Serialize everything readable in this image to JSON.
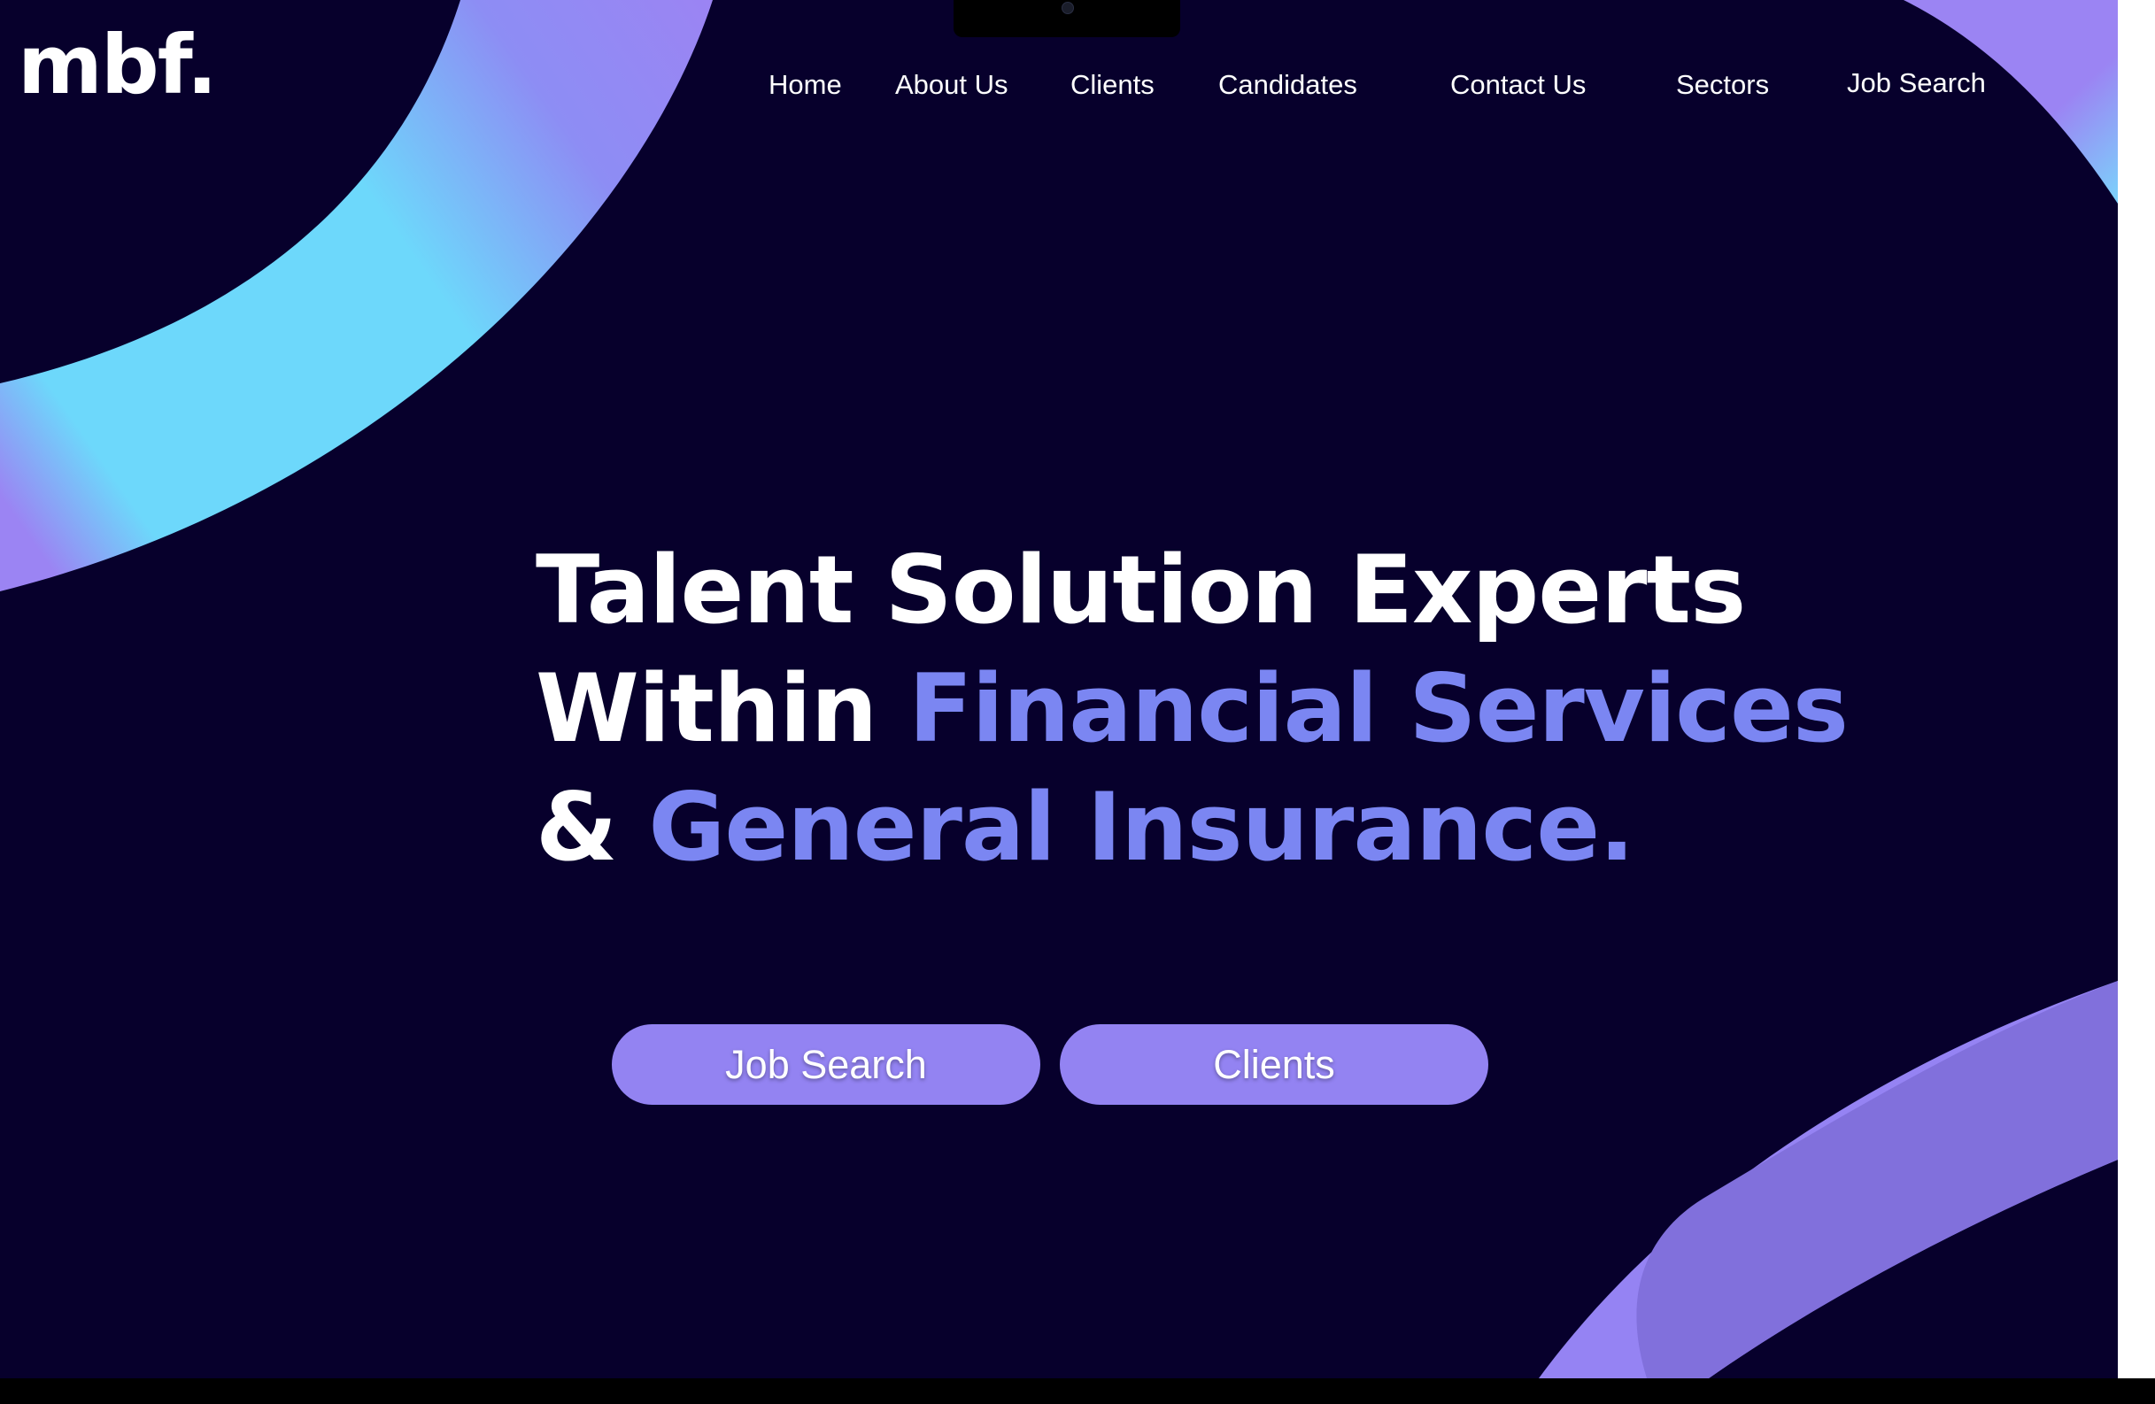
{
  "brand": {
    "logo_text": "mbf."
  },
  "nav": {
    "items": [
      {
        "label": "Home"
      },
      {
        "label": "About Us"
      },
      {
        "label": "Clients"
      },
      {
        "label": "Candidates"
      },
      {
        "label": "Contact Us"
      },
      {
        "label": "Sectors"
      },
      {
        "label": "Job Search"
      }
    ]
  },
  "hero": {
    "line1": "Talent Solution Experts",
    "line2_white": "Within ",
    "line2_accent": "Financial Services",
    "line3_white": "& ",
    "line3_accent": "General Insurance."
  },
  "cta": {
    "primary_label": "Job Search",
    "secondary_label": "Clients"
  },
  "colors": {
    "background": "#07002c",
    "accent_text": "#7b86f2",
    "button": "#9383f2",
    "ribbon_cyan": "#6dd8fb",
    "ribbon_purple": "#9b84f3"
  },
  "icons": {
    "camera": "webcam-icon"
  }
}
